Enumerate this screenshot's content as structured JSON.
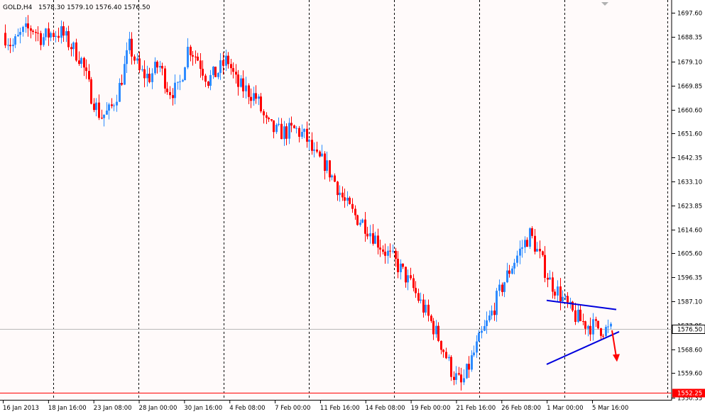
{
  "header": {
    "symbol": "GOLD,H4",
    "ohlc": "1578.30 1579.10 1576.40 1576.50"
  },
  "chart_data": {
    "type": "candlestick",
    "symbol": "GOLD",
    "timeframe": "H4",
    "ylim": [
      1549.4,
      1702.6
    ],
    "y_ticks": [
      "1697.60",
      "1688.35",
      "1679.10",
      "1669.85",
      "1660.60",
      "1651.60",
      "1642.35",
      "1633.10",
      "1623.85",
      "1614.60",
      "1605.60",
      "1596.35",
      "1587.10",
      "1577.85",
      "1568.60",
      "1559.60",
      "1550.35"
    ],
    "x_ticks": [
      "16 Jan 2013",
      "18 Jan 16:00",
      "23 Jan 08:00",
      "28 Jan 00:00",
      "30 Jan 16:00",
      "4 Feb 08:00",
      "7 Feb 00:00",
      "11 Feb 16:00",
      "14 Feb 08:00",
      "19 Feb 00:00",
      "21 Feb 16:00",
      "26 Feb 08:00",
      "1 Mar 00:00",
      "5 Mar 16:00"
    ],
    "current_price": "1576.50",
    "support_line_price": "1552.25",
    "colors": {
      "bull": "#2e8bff",
      "bear": "#ff0000",
      "triangle": "#0000dd",
      "arrow": "#ff0000",
      "support": "#ff0000",
      "background": "#fffafa"
    },
    "trend_levels": [
      1690,
      1685,
      1690,
      1692,
      1688,
      1690,
      1690,
      1685,
      1680,
      1667,
      1658,
      1660,
      1670,
      1685,
      1675,
      1673,
      1678,
      1668,
      1668,
      1685,
      1680,
      1672,
      1675,
      1680,
      1670,
      1668,
      1665,
      1655,
      1652,
      1652,
      1653,
      1650,
      1642,
      1640,
      1633,
      1625,
      1620,
      1617,
      1612,
      1607,
      1603,
      1598,
      1592,
      1585,
      1578,
      1570,
      1560,
      1555,
      1565,
      1574,
      1582,
      1592,
      1600,
      1607,
      1613,
      1604,
      1595,
      1590,
      1584,
      1580,
      1578,
      1577,
      1576
    ]
  }
}
